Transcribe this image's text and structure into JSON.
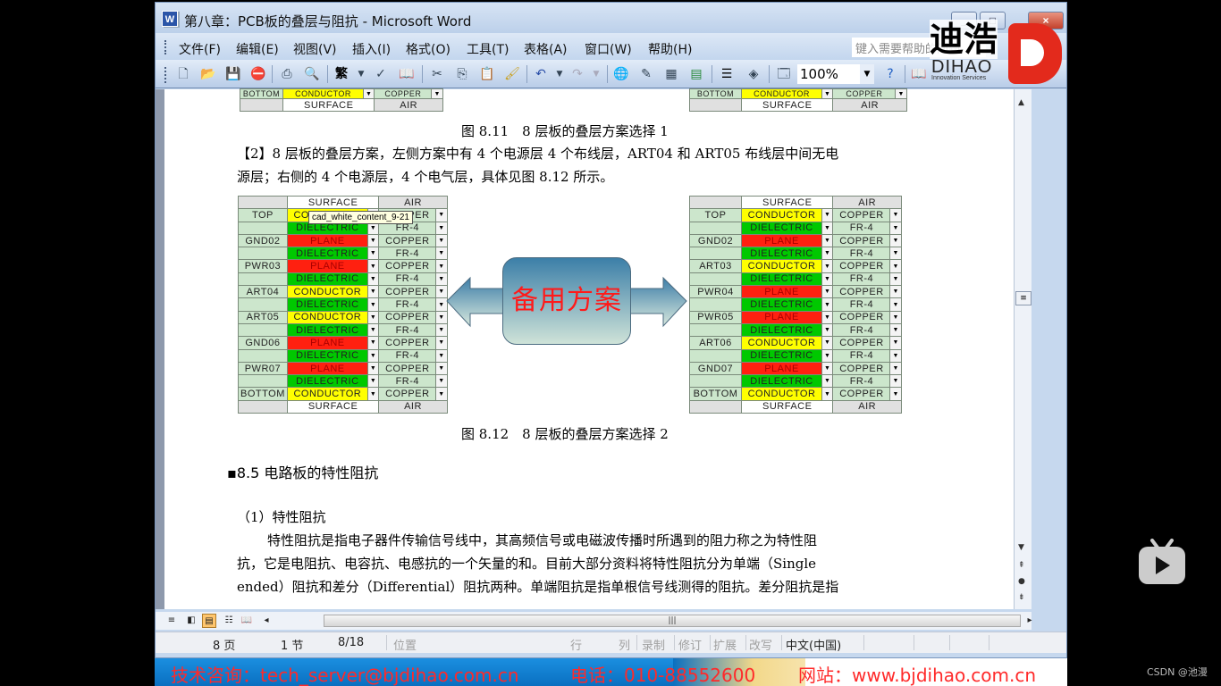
{
  "window": {
    "title": "第八章：PCB板的叠层与阻抗 - Microsoft Word",
    "app_icon": "word-doc-icon",
    "controls": {
      "minimize": "_",
      "maximize": "□",
      "close": "×"
    }
  },
  "menubar": {
    "items": [
      "文件(F)",
      "编辑(E)",
      "视图(V)",
      "插入(I)",
      "格式(O)",
      "工具(T)",
      "表格(A)",
      "窗口(W)",
      "帮助(H)"
    ],
    "help_placeholder": "键入需要帮助的问题"
  },
  "toolbar": {
    "icons": [
      "new-document-icon",
      "open-folder-icon",
      "save-icon",
      "permission-icon",
      "print-icon",
      "print-preview-icon",
      "traditional-chinese-icon",
      "dropdown-icon",
      "spelling-icon",
      "research-icon",
      "cut-icon",
      "copy-icon",
      "paste-icon",
      "format-painter-icon",
      "undo-icon",
      "undo-dropdown-icon",
      "redo-icon",
      "redo-dropdown-icon",
      "hyperlink-icon",
      "tables-borders-icon",
      "insert-table-icon",
      "insert-excel-icon",
      "columns-icon",
      "drawing-icon",
      "document-map-icon",
      "help-icon",
      "read-icon"
    ],
    "traditional_glyph": "繁",
    "zoom": "100%"
  },
  "logo": {
    "cn": "迪浩",
    "en": "DIHAO",
    "sub": "Innovation Services"
  },
  "document": {
    "prev_table_tail": {
      "bottom_row": {
        "label": "BOTTOM",
        "material": "CONDUCTOR",
        "sub": "COPPER"
      },
      "footer": {
        "surface": "SURFACE",
        "air": "AIR"
      }
    },
    "caption_811": "图 8.11　8 层板的叠层方案选择 1",
    "para_2_line1": "【2】8 层板的叠层方案，左侧方案中有 4 个电源层 4 个布线层，ART04 和 ART05 布线层中间无电",
    "para_2_line2": "源层；右侧的 4 个电源层，4 个电气层，具体见图 8.12 所示。",
    "tooltip": "cad_white_content_9-21",
    "center_label": "备用方案",
    "caption_812": "图 8.12　8 层板的叠层方案选择 2",
    "heading_85": "8.5  电路板的特性阻抗",
    "subheading_1": "（1）特性阻抗",
    "body_line1": "特性阻抗是指电子器件传输信号线中，其高频信号或电磁波传播时所遇到的阻力称之为特性阻",
    "body_line2": "抗，它是电阻抗、电容抗、电感抗的一个矢量的和。目前大部分资料将特性阻抗分为单端（Single",
    "body_line3": "ended）阻抗和差分（Differential）阻抗两种。单端阻抗是指单根信号线测得的阻抗。差分阻抗是指"
  },
  "stackup_left": {
    "header": {
      "surface": "SURFACE",
      "air": "AIR"
    },
    "rows": [
      {
        "label": "TOP",
        "material": "CONDUCTOR",
        "type": "conductor",
        "sub": "COPPER"
      },
      {
        "label": "",
        "material": "DIELECTRIC",
        "type": "dielectric",
        "sub": "FR-4"
      },
      {
        "label": "GND02",
        "material": "PLANE",
        "type": "plane",
        "sub": "COPPER"
      },
      {
        "label": "",
        "material": "DIELECTRIC",
        "type": "dielectric",
        "sub": "FR-4"
      },
      {
        "label": "PWR03",
        "material": "PLANE",
        "type": "plane",
        "sub": "COPPER"
      },
      {
        "label": "",
        "material": "DIELECTRIC",
        "type": "dielectric",
        "sub": "FR-4"
      },
      {
        "label": "ART04",
        "material": "CONDUCTOR",
        "type": "conductor",
        "sub": "COPPER"
      },
      {
        "label": "",
        "material": "DIELECTRIC",
        "type": "dielectric",
        "sub": "FR-4"
      },
      {
        "label": "ART05",
        "material": "CONDUCTOR",
        "type": "conductor",
        "sub": "COPPER"
      },
      {
        "label": "",
        "material": "DIELECTRIC",
        "type": "dielectric",
        "sub": "FR-4"
      },
      {
        "label": "GND06",
        "material": "PLANE",
        "type": "plane",
        "sub": "COPPER"
      },
      {
        "label": "",
        "material": "DIELECTRIC",
        "type": "dielectric",
        "sub": "FR-4"
      },
      {
        "label": "PWR07",
        "material": "PLANE",
        "type": "plane",
        "sub": "COPPER"
      },
      {
        "label": "",
        "material": "DIELECTRIC",
        "type": "dielectric",
        "sub": "FR-4"
      },
      {
        "label": "BOTTOM",
        "material": "CONDUCTOR",
        "type": "conductor",
        "sub": "COPPER"
      }
    ],
    "footer": {
      "surface": "SURFACE",
      "air": "AIR"
    }
  },
  "stackup_right": {
    "header": {
      "surface": "SURFACE",
      "air": "AIR"
    },
    "rows": [
      {
        "label": "TOP",
        "material": "CONDUCTOR",
        "type": "conductor",
        "sub": "COPPER"
      },
      {
        "label": "",
        "material": "DIELECTRIC",
        "type": "dielectric",
        "sub": "FR-4"
      },
      {
        "label": "GND02",
        "material": "PLANE",
        "type": "plane",
        "sub": "COPPER"
      },
      {
        "label": "",
        "material": "DIELECTRIC",
        "type": "dielectric",
        "sub": "FR-4"
      },
      {
        "label": "ART03",
        "material": "CONDUCTOR",
        "type": "conductor",
        "sub": "COPPER"
      },
      {
        "label": "",
        "material": "DIELECTRIC",
        "type": "dielectric",
        "sub": "FR-4"
      },
      {
        "label": "PWR04",
        "material": "PLANE",
        "type": "plane",
        "sub": "COPPER"
      },
      {
        "label": "",
        "material": "DIELECTRIC",
        "type": "dielectric",
        "sub": "FR-4"
      },
      {
        "label": "PWR05",
        "material": "PLANE",
        "type": "plane",
        "sub": "COPPER"
      },
      {
        "label": "",
        "material": "DIELECTRIC",
        "type": "dielectric",
        "sub": "FR-4"
      },
      {
        "label": "ART06",
        "material": "CONDUCTOR",
        "type": "conductor",
        "sub": "COPPER"
      },
      {
        "label": "",
        "material": "DIELECTRIC",
        "type": "dielectric",
        "sub": "FR-4"
      },
      {
        "label": "GND07",
        "material": "PLANE",
        "type": "plane",
        "sub": "COPPER"
      },
      {
        "label": "",
        "material": "DIELECTRIC",
        "type": "dielectric",
        "sub": "FR-4"
      },
      {
        "label": "BOTTOM",
        "material": "CONDUCTOR",
        "type": "conductor",
        "sub": "COPPER"
      }
    ],
    "footer": {
      "surface": "SURFACE",
      "air": "AIR"
    }
  },
  "statusbar": {
    "page": "8 页",
    "section": "1 节",
    "page_of": "8/18",
    "position": "位置",
    "line": "行",
    "column": "列",
    "record": "录制",
    "revise": "修订",
    "extend": "扩展",
    "overtype": "改写",
    "language": "中文(中国)"
  },
  "infobar": {
    "consult": "技术咨询：tech_server@bjdihao.com.cn",
    "phone": "电话：010-88552600",
    "website": "网站：www.bjdihao.com.cn"
  },
  "overlay": {
    "watermark": "CSDN @池漫"
  }
}
